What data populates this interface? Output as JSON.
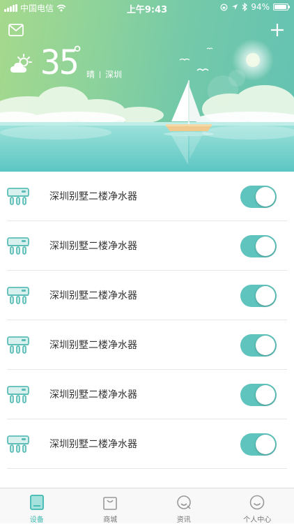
{
  "status_bar": {
    "carrier": "中国电信",
    "time": "上午9:43",
    "battery": "94%",
    "battery_level": 0.94
  },
  "header": {
    "mail_icon": "mail-icon",
    "add_icon": "plus-icon"
  },
  "weather": {
    "icon": "partly-cloudy-icon",
    "temperature": "35",
    "degree_symbol": "°",
    "condition": "晴",
    "city": "深圳"
  },
  "devices": [
    {
      "name": "深圳别墅二楼净水器",
      "on": true
    },
    {
      "name": "深圳别墅二楼净水器",
      "on": true
    },
    {
      "name": "深圳别墅二楼净水器",
      "on": true
    },
    {
      "name": "深圳别墅二楼净水器",
      "on": true
    },
    {
      "name": "深圳别墅二楼净水器",
      "on": true
    },
    {
      "name": "深圳别墅二楼净水器",
      "on": true
    }
  ],
  "tabs": [
    {
      "label": "设备",
      "icon": "device-icon",
      "active": true
    },
    {
      "label": "商城",
      "icon": "shopping-bag-icon",
      "active": false
    },
    {
      "label": "资讯",
      "icon": "news-search-icon",
      "active": false
    },
    {
      "label": "个人中心",
      "icon": "smiley-profile-icon",
      "active": false
    }
  ],
  "colors": {
    "accent": "#3fb8b0",
    "toggle_on": "#5fc4bd",
    "hero_start": "#a6d98c",
    "hero_end": "#63c2b3"
  }
}
